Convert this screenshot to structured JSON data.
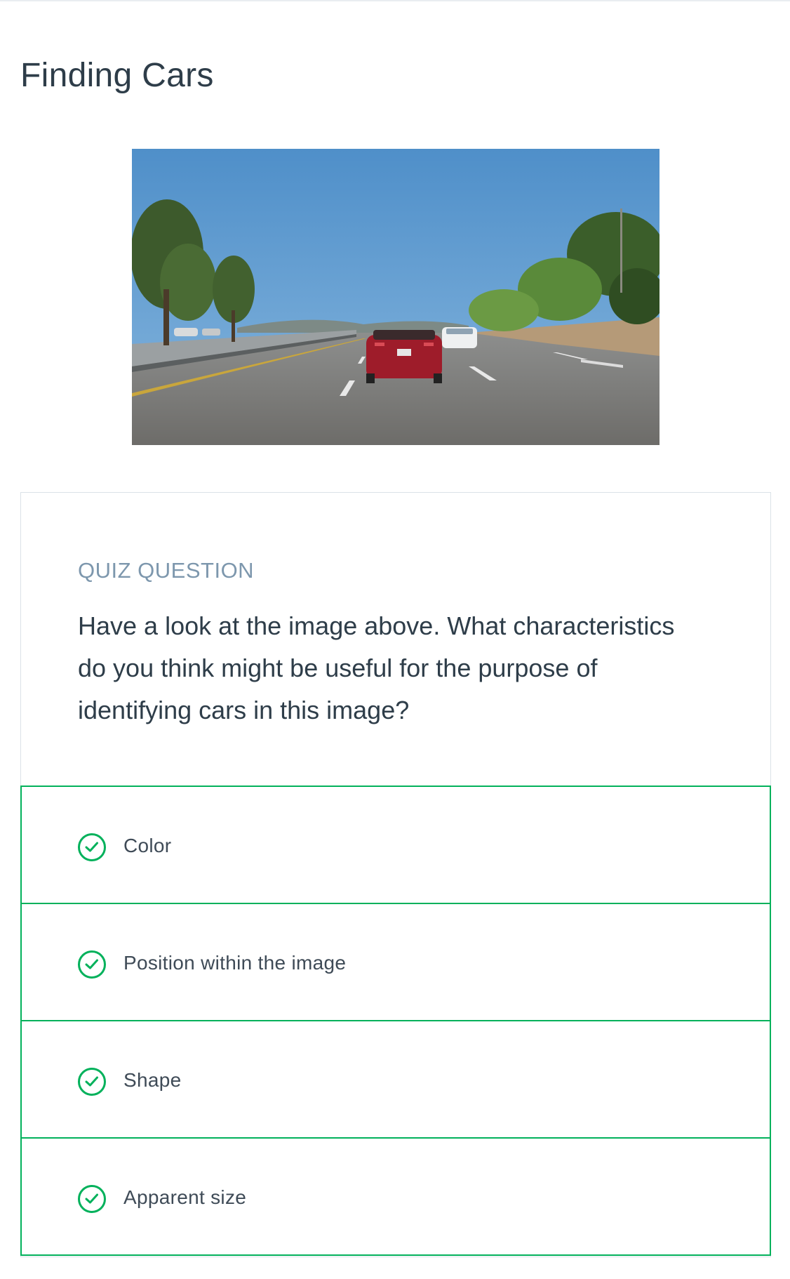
{
  "page": {
    "title": "Finding Cars"
  },
  "quiz": {
    "label": "QUIZ QUESTION",
    "prompt": "Have a look at the image above. What characteristics do you think might be useful for the purpose of identifying cars in this image?",
    "options": [
      {
        "label": "Color",
        "state": "correct"
      },
      {
        "label": "Position within the image",
        "state": "correct"
      },
      {
        "label": "Shape",
        "state": "correct"
      },
      {
        "label": "Apparent size",
        "state": "correct"
      }
    ]
  },
  "colors": {
    "title": "#2e3d49",
    "quiz_label": "#7d97ad",
    "option_border": "#02b15b",
    "check": "#02b15b"
  },
  "icons": {
    "option_check": "check-circle-icon"
  }
}
